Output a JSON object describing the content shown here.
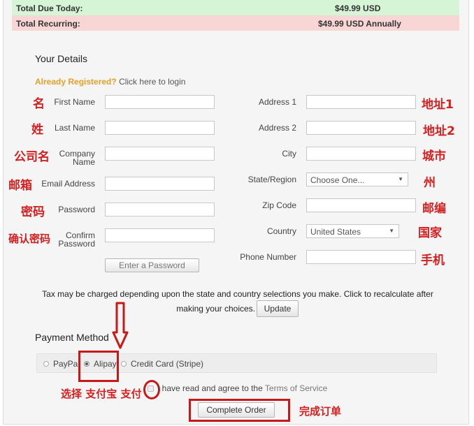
{
  "totals": {
    "due_label": "Total Due Today:",
    "due_value": "$49.99 USD",
    "recurring_label": "Total Recurring:",
    "recurring_value": "$49.99 USD Annually"
  },
  "details": {
    "title": "Your Details",
    "registered_prefix": "Already Registered?",
    "login_link": "Click here to login"
  },
  "left_fields": {
    "first_name": "First Name",
    "last_name": "Last Name",
    "company_line1": "Company",
    "company_line2": "Name",
    "email": "Email Address",
    "password": "Password",
    "confirm_line1": "Confirm",
    "confirm_line2": "Password",
    "enter_password_button": "Enter a Password"
  },
  "right_fields": {
    "address1": "Address 1",
    "address2": "Address 2",
    "city": "City",
    "state": "State/Region",
    "state_select": "Choose One...",
    "zip": "Zip Code",
    "country": "Country",
    "country_select": "United States",
    "phone": "Phone Number"
  },
  "annotations": {
    "first_name": "名",
    "last_name": "姓",
    "company": "公司名",
    "email": "邮箱",
    "password": "密码",
    "confirm": "确认密码",
    "address1": "地址1",
    "address2": "地址2",
    "city": "城市",
    "state": "州",
    "zip": "邮编",
    "country": "国家",
    "phone": "手机",
    "select_alipay": "选择 支付宝 支付",
    "complete": "完成订单"
  },
  "tax": {
    "line1": "Tax may be charged depending upon the state and country selections you make. Click to recalculate after",
    "line2": "making your choices.",
    "update_button": "Update"
  },
  "payment": {
    "title": "Payment Method",
    "options": [
      "PayPal",
      "Alipay",
      "Credit Card (Stripe)"
    ],
    "selected": "Alipay"
  },
  "terms": {
    "text": "I have read and agree to the",
    "link": "Terms of Service"
  },
  "complete_button": "Complete Order",
  "colors": {
    "annotation_red": "#d42020",
    "due_bg": "#d6f5d6",
    "recurring_bg": "#f9d6d6",
    "registered_orange": "#e6a029"
  }
}
